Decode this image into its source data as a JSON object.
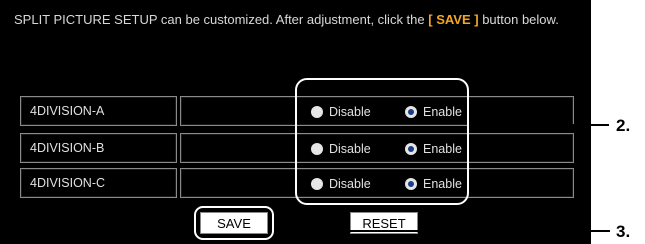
{
  "intro": {
    "text_before": "SPLIT PICTURE SETUP can be customized. After adjustment, click the ",
    "save_word": "[ SAVE ]",
    "text_after": " button below."
  },
  "rows": [
    {
      "name": "4DIVISION-A",
      "disable_label": "Disable",
      "enable_label": "Enable",
      "selected": "Enable"
    },
    {
      "name": "4DIVISION-B",
      "disable_label": "Disable",
      "enable_label": "Enable",
      "selected": "Enable"
    },
    {
      "name": "4DIVISION-C",
      "disable_label": "Disable",
      "enable_label": "Enable",
      "selected": "Enable"
    }
  ],
  "buttons": {
    "save": "SAVE",
    "reset": "RESET"
  },
  "callouts": {
    "radios": "2.",
    "save": "3."
  },
  "colors": {
    "background": "#000000",
    "highlight": "#f5a623",
    "radio_fill": "#1a3e8c"
  }
}
